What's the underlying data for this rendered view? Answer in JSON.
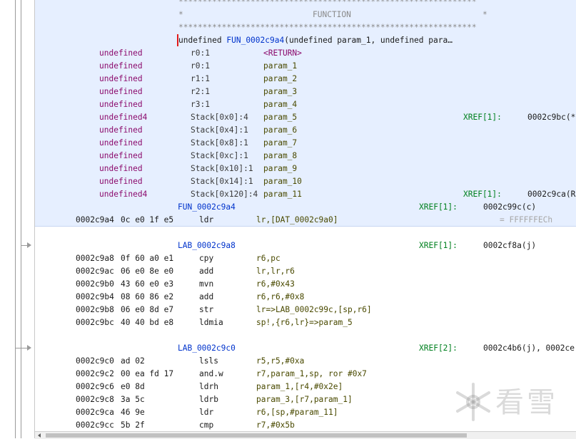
{
  "header": {
    "stars": "**************************************************************",
    "star_left": "*",
    "title": "FUNCTION",
    "star_right": "*"
  },
  "signature": {
    "return_type": "undefined",
    "name": "FUN_0002c9a4",
    "args": "(undefined param_1, undefined para…"
  },
  "params": [
    {
      "type": "undefined",
      "storage": "r0:1",
      "name": "<RETURN>",
      "xref": "",
      "xref_addr": ""
    },
    {
      "type": "undefined",
      "storage": "r0:1",
      "name": "param_1",
      "xref": "",
      "xref_addr": ""
    },
    {
      "type": "undefined",
      "storage": "r1:1",
      "name": "param_2",
      "xref": "",
      "xref_addr": ""
    },
    {
      "type": "undefined",
      "storage": "r2:1",
      "name": "param_3",
      "xref": "",
      "xref_addr": ""
    },
    {
      "type": "undefined",
      "storage": "r3:1",
      "name": "param_4",
      "xref": "",
      "xref_addr": ""
    },
    {
      "type": "undefined4",
      "storage": "Stack[0x0]:4",
      "name": "param_5",
      "xref": "XREF[1]:",
      "xref_addr": "0002c9bc(*"
    },
    {
      "type": "undefined",
      "storage": "Stack[0x4]:1",
      "name": "param_6",
      "xref": "",
      "xref_addr": ""
    },
    {
      "type": "undefined",
      "storage": "Stack[0x8]:1",
      "name": "param_7",
      "xref": "",
      "xref_addr": ""
    },
    {
      "type": "undefined",
      "storage": "Stack[0xc]:1",
      "name": "param_8",
      "xref": "",
      "xref_addr": ""
    },
    {
      "type": "undefined",
      "storage": "Stack[0x10]:1",
      "name": "param_9",
      "xref": "",
      "xref_addr": ""
    },
    {
      "type": "undefined",
      "storage": "Stack[0x14]:1",
      "name": "param_10",
      "xref": "",
      "xref_addr": ""
    },
    {
      "type": "undefined4",
      "storage": "Stack[0x120]:4",
      "name": "param_11",
      "xref": "XREF[1]:",
      "xref_addr": "0002c9ca(R"
    }
  ],
  "func_label": {
    "name": "FUN_0002c9a4",
    "xref": "XREF[1]:",
    "xref_addr": "0002c99c(c)"
  },
  "first_instr": {
    "addr": "0002c9a4",
    "bytes": "0c e0 1f e5",
    "mnem": "ldr",
    "ops": "lr,[DAT_0002c9a0]",
    "hint": "= FFFFFFECh"
  },
  "block1": {
    "label": "LAB_0002c9a8",
    "xref": "XREF[1]:",
    "xref_addr": "0002cf8a(j)",
    "instrs": [
      {
        "addr": "0002c9a8",
        "bytes": "0f 60 a0 e1",
        "mnem": "cpy",
        "ops": "r6,pc"
      },
      {
        "addr": "0002c9ac",
        "bytes": "06 e0 8e e0",
        "mnem": "add",
        "ops": "lr,lr,r6"
      },
      {
        "addr": "0002c9b0",
        "bytes": "43 60 e0 e3",
        "mnem": "mvn",
        "ops": "r6,#0x43"
      },
      {
        "addr": "0002c9b4",
        "bytes": "08 60 86 e2",
        "mnem": "add",
        "ops": "r6,r6,#0x8"
      },
      {
        "addr": "0002c9b8",
        "bytes": "06 e0 8d e7",
        "mnem": "str",
        "ops": "lr=>LAB_0002c99c,[sp,r6]"
      },
      {
        "addr": "0002c9bc",
        "bytes": "40 40 bd e8",
        "mnem": "ldmia",
        "ops": "sp!,{r6,lr}=>param_5"
      }
    ]
  },
  "block2": {
    "label": "LAB_0002c9c0",
    "xref": "XREF[2]:",
    "xref_addr": "0002c4b6(j), 0002ce",
    "instrs": [
      {
        "addr": "0002c9c0",
        "bytes": "ad 02",
        "mnem": "lsls",
        "ops": "r5,r5,#0xa"
      },
      {
        "addr": "0002c9c2",
        "bytes": "00 ea fd 17",
        "mnem": "and.w",
        "ops": "r7,param_1,sp, ror #0x7"
      },
      {
        "addr": "0002c9c6",
        "bytes": "e0 8d",
        "mnem": "ldrh",
        "ops": "param_1,[r4,#0x2e]"
      },
      {
        "addr": "0002c9c8",
        "bytes": "3a 5c",
        "mnem": "ldrb",
        "ops": "param_3,[r7,param_1]"
      },
      {
        "addr": "0002c9ca",
        "bytes": "46 9e",
        "mnem": "ldr",
        "ops": "r6,[sp,#param_11]"
      },
      {
        "addr": "0002c9cc",
        "bytes": "5b 2f",
        "mnem": "cmp",
        "ops": "r7,#0x5b"
      }
    ]
  },
  "watermark": {
    "text": "看雪",
    "icon": "snowflake-icon"
  },
  "colors": {
    "func_bg": "#e6efff",
    "type": "#8b0a6c",
    "label": "#0033cc",
    "xref": "#00801f",
    "cursor": "#e31a1a"
  }
}
